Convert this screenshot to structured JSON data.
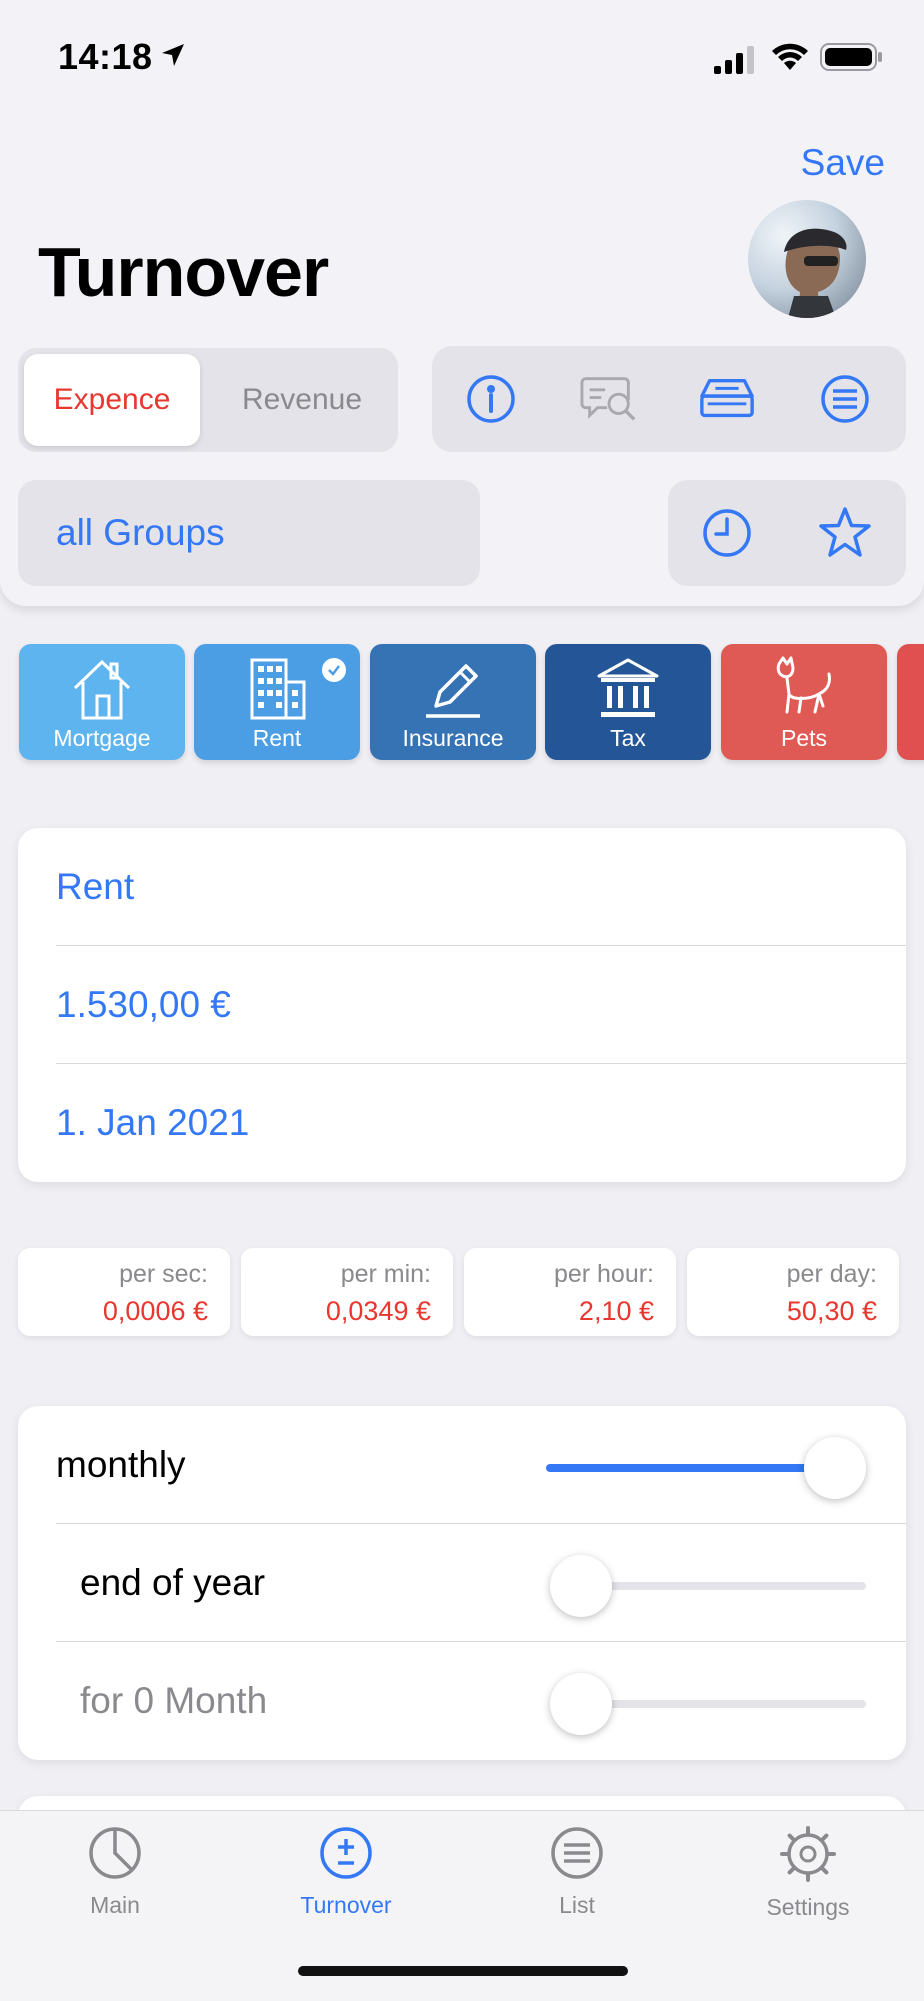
{
  "status_bar": {
    "time": "14:18"
  },
  "header": {
    "save_label": "Save",
    "title": "Turnover",
    "avatar": "profile-photo"
  },
  "segment": {
    "options": [
      "Expence",
      "Revenue"
    ],
    "selected": "Expence"
  },
  "toolbar": {
    "icons": [
      "info-icon",
      "search-review-icon",
      "scanner-icon",
      "list-icon"
    ]
  },
  "groups_filter": {
    "label": "all Groups"
  },
  "quick_actions": {
    "icons": [
      "history-icon",
      "favorite-star-icon"
    ]
  },
  "categories": [
    {
      "label": "Mortgage",
      "icon": "house-icon",
      "color": "#5EB4EE",
      "selected": false
    },
    {
      "label": "Rent",
      "icon": "building-icon",
      "color": "#4B9DE4",
      "selected": true
    },
    {
      "label": "Insurance",
      "icon": "pencil-icon",
      "color": "#3673B5",
      "selected": false
    },
    {
      "label": "Tax",
      "icon": "bank-icon",
      "color": "#245597",
      "selected": false
    },
    {
      "label": "Pets",
      "icon": "cat-icon",
      "color": "#E05A55",
      "selected": false
    }
  ],
  "entry": {
    "name": "Rent",
    "amount": "1.530,00 €",
    "date": "1. Jan 2021"
  },
  "rates": [
    {
      "label": "per sec:",
      "value": "0,0006 €"
    },
    {
      "label": "per min:",
      "value": "0,0349 €"
    },
    {
      "label": "per hour:",
      "value": "2,10 €"
    },
    {
      "label": "per day:",
      "value": "50,30 €"
    }
  ],
  "recurrence": {
    "monthly_label": "monthly",
    "monthly_value": 1.0,
    "end_of_year_label": "end of year",
    "end_of_year_value": 0,
    "for_months_label": "for 0 Month",
    "for_months_value": 0
  },
  "tabs": [
    {
      "label": "Main",
      "icon": "pie-chart-icon",
      "active": false
    },
    {
      "label": "Turnover",
      "icon": "plus-minus-icon",
      "active": true
    },
    {
      "label": "List",
      "icon": "list-icon",
      "active": false
    },
    {
      "label": "Settings",
      "icon": "gear-icon",
      "active": false
    }
  ],
  "colors": {
    "accent": "#3478F6",
    "expense": "#E8372E",
    "inactive": "#8A8A8E"
  }
}
